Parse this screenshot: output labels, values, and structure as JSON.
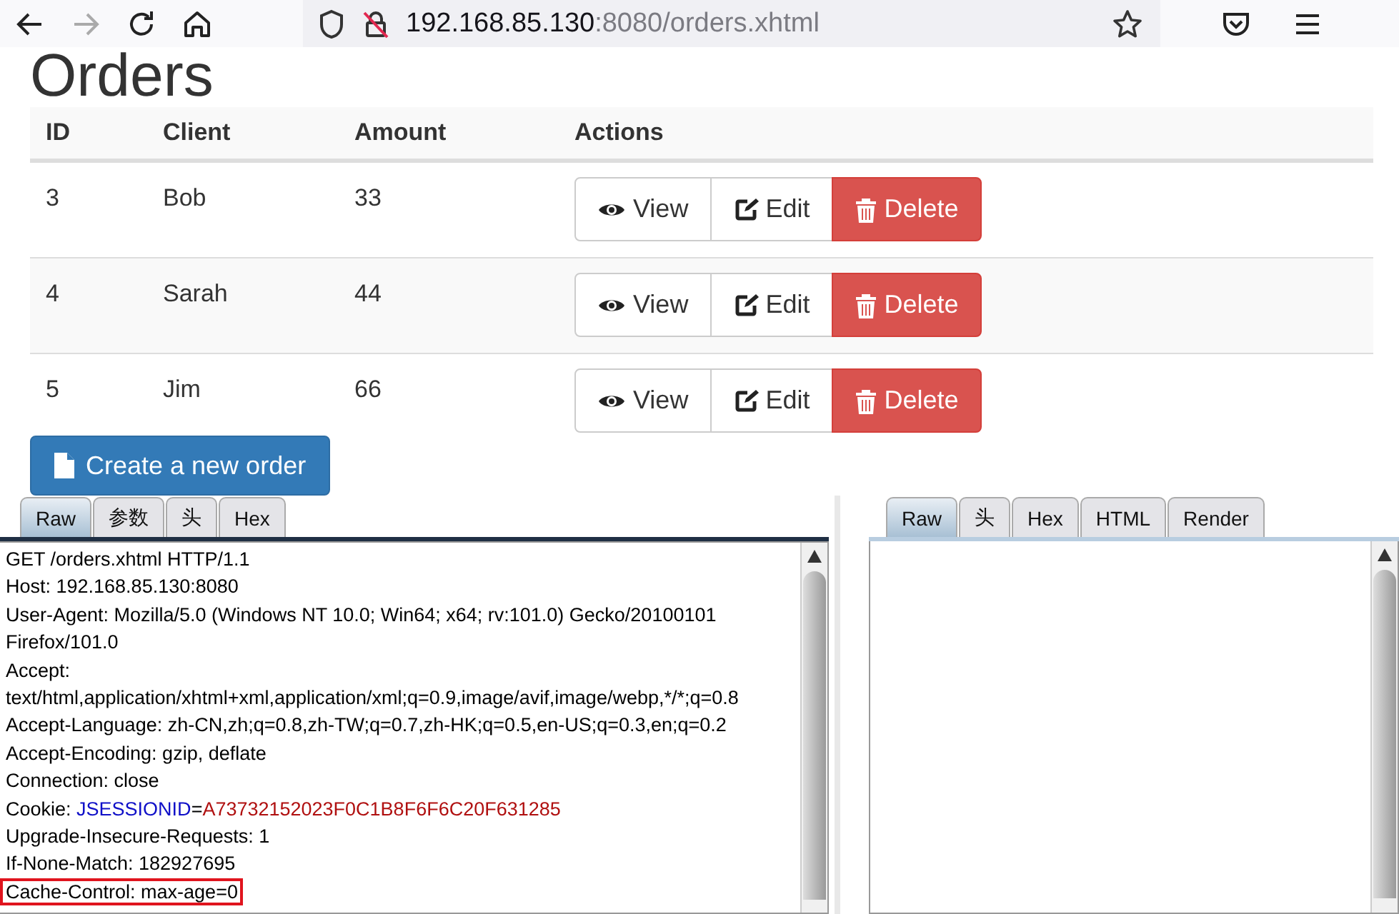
{
  "browser": {
    "back_disabled": false,
    "forward_disabled": true,
    "url_host": "192.168.85.130",
    "url_rest": ":8080/orders.xhtml"
  },
  "page": {
    "title": "Orders",
    "table": {
      "columns": [
        "ID",
        "Client",
        "Amount",
        "Actions"
      ],
      "rows": [
        {
          "id": "3",
          "client": "Bob",
          "amount": "33",
          "actions": [
            {
              "kind": "view",
              "label": "View"
            },
            {
              "kind": "edit",
              "label": "Edit"
            },
            {
              "kind": "delete",
              "label": "Delete"
            }
          ]
        },
        {
          "id": "4",
          "client": "Sarah",
          "amount": "44",
          "actions": [
            {
              "kind": "view",
              "label": "View"
            },
            {
              "kind": "edit",
              "label": "Edit"
            },
            {
              "kind": "delete",
              "label": "Delete"
            }
          ]
        },
        {
          "id": "5",
          "client": "Jim",
          "amount": "66",
          "actions": [
            {
              "kind": "view",
              "label": "View"
            },
            {
              "kind": "edit",
              "label": "Edit"
            },
            {
              "kind": "delete",
              "label": "Delete"
            }
          ]
        }
      ]
    },
    "create_button": "Create a new order"
  },
  "request_panel": {
    "tabs": [
      {
        "label": "Raw",
        "selected": true
      },
      {
        "label": "参数",
        "selected": false
      },
      {
        "label": "头",
        "selected": false
      },
      {
        "label": "Hex",
        "selected": false
      }
    ],
    "lines": [
      {
        "kind": "plain",
        "text": "GET /orders.xhtml HTTP/1.1",
        "highlighted": false
      },
      {
        "kind": "plain",
        "text": "Host: 192.168.85.130:8080",
        "highlighted": false
      },
      {
        "kind": "plain",
        "text": "User-Agent: Mozilla/5.0 (Windows NT 10.0; Win64; x64; rv:101.0) Gecko/20100101",
        "highlighted": false
      },
      {
        "kind": "plain",
        "text": "Firefox/101.0",
        "highlighted": false
      },
      {
        "kind": "plain",
        "text": "Accept:",
        "highlighted": false
      },
      {
        "kind": "plain",
        "text": "text/html,application/xhtml+xml,application/xml;q=0.9,image/avif,image/webp,*/*;q=0.8",
        "highlighted": false
      },
      {
        "kind": "plain",
        "text": "Accept-Language: zh-CN,zh;q=0.8,zh-TW;q=0.7,zh-HK;q=0.5,en-US;q=0.3,en;q=0.2",
        "highlighted": false
      },
      {
        "kind": "plain",
        "text": "Accept-Encoding: gzip, deflate",
        "highlighted": false
      },
      {
        "kind": "plain",
        "text": "Connection: close",
        "highlighted": false
      },
      {
        "kind": "cookie",
        "label": "Cookie: ",
        "cookie_name": "JSESSIONID",
        "separator": "=",
        "cookie_value": "A73732152023F0C1B8F6F6C20F631285",
        "highlighted": false
      },
      {
        "kind": "plain",
        "text": "Upgrade-Insecure-Requests: 1",
        "highlighted": false
      },
      {
        "kind": "plain",
        "text": "If-None-Match: 182927695",
        "highlighted": false
      },
      {
        "kind": "plain",
        "text": "Cache-Control: max-age=0",
        "highlighted": true
      }
    ]
  },
  "response_panel": {
    "tabs": [
      {
        "label": "Raw",
        "selected": true
      },
      {
        "label": "头",
        "selected": false
      },
      {
        "label": "Hex",
        "selected": false
      },
      {
        "label": "HTML",
        "selected": false
      },
      {
        "label": "Render",
        "selected": false
      }
    ]
  }
}
